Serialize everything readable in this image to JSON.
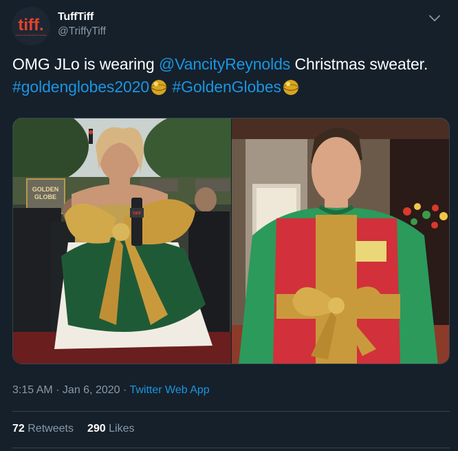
{
  "author": {
    "display_name": "TuffTiff",
    "handle": "@TriffyTiff",
    "avatar_text": "tiff.",
    "avatar_subtext": "Toronto International Film Festival"
  },
  "tweet": {
    "text_1": "OMG JLo is wearing ",
    "mention": "@VancityReynolds",
    "text_2": " Christmas sweater. ",
    "hashtag_1": "#goldenglobes2020",
    "hashtag_2": "#GoldenGlobes",
    "emoji_icon": "golden-globe-emoji-icon"
  },
  "media": {
    "left_image": "jlo-green-gold-bow-gown-photo",
    "right_image": "ryan-reynolds-gift-sweater-photo",
    "sign_text_1": "GOLDEN",
    "sign_text_2": "GLOBE",
    "mic_flag_text": "TIFF"
  },
  "meta": {
    "time": "3:15 AM",
    "separator": " · ",
    "date": "Jan 6, 2020",
    "app": "Twitter Web App"
  },
  "stats": {
    "retweets_count": "72",
    "retweets_label": "Retweets",
    "likes_count": "290",
    "likes_label": "Likes"
  },
  "colors": {
    "background": "#15202b",
    "link": "#1b95e0",
    "secondary_text": "#8899a6",
    "divider": "#38444d",
    "avatar_red": "#e8412c"
  }
}
